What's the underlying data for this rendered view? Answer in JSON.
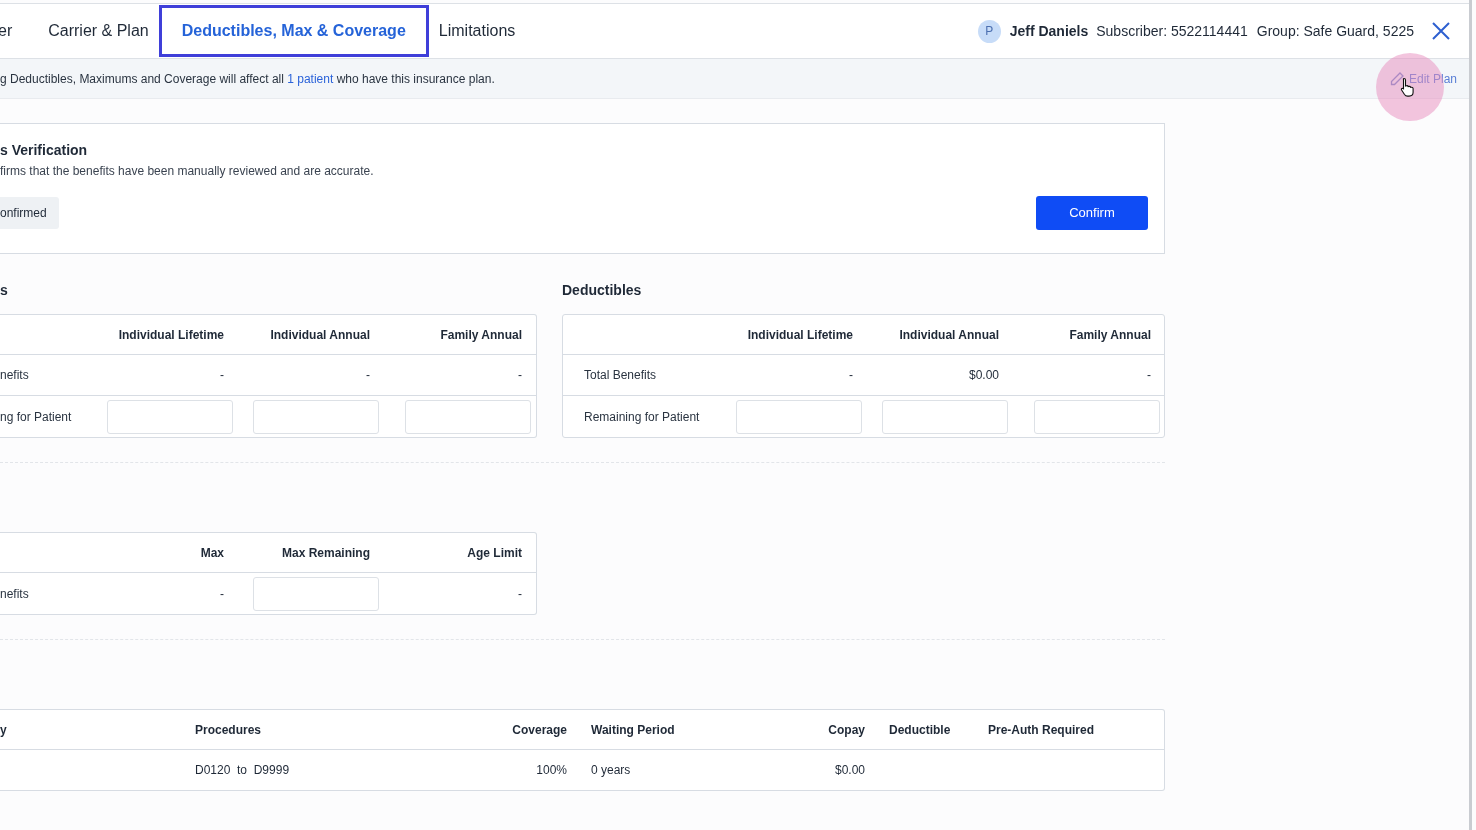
{
  "tabs": [
    {
      "label": "er",
      "selected": false
    },
    {
      "label": "Carrier & Plan",
      "selected": false
    },
    {
      "label": "Deductibles, Max & Coverage",
      "selected": true
    },
    {
      "label": "Limitations",
      "selected": false
    }
  ],
  "patient": {
    "avatar": "P",
    "name": "Jeff Daniels",
    "subscriber": "Subscriber: 5522114441",
    "group": "Group: Safe Guard, 5225"
  },
  "notice": {
    "before": "g Deductibles, Maximums and Coverage will affect all",
    "link": "1 patient",
    "after": "who have this insurance plan.",
    "edit_plan": "Edit Plan"
  },
  "verification": {
    "title": "s Verification",
    "description": "firms that the benefits have been manually reviewed and are accurate.",
    "status": "onfirmed",
    "confirm_button": "Confirm"
  },
  "maximums": {
    "heading": "s",
    "columns": [
      "",
      "Individual Lifetime",
      "Individual Annual",
      "Family Annual"
    ],
    "rows": [
      {
        "cells": [
          {
            "kind": "label",
            "value": "nefits"
          },
          {
            "kind": "text",
            "value": "-"
          },
          {
            "kind": "text",
            "value": "-"
          },
          {
            "kind": "text",
            "value": "-"
          }
        ]
      },
      {
        "cells": [
          {
            "kind": "label",
            "value": "ng for Patient"
          },
          {
            "kind": "input"
          },
          {
            "kind": "input"
          },
          {
            "kind": "input"
          }
        ]
      }
    ]
  },
  "deductibles": {
    "heading": "Deductibles",
    "columns": [
      "",
      "Individual Lifetime",
      "Individual Annual",
      "Family Annual"
    ],
    "rows": [
      {
        "cells": [
          {
            "kind": "label",
            "value": "Total Benefits"
          },
          {
            "kind": "text",
            "value": "-"
          },
          {
            "kind": "text",
            "value": "$0.00"
          },
          {
            "kind": "text",
            "value": "-"
          }
        ]
      },
      {
        "cells": [
          {
            "kind": "label",
            "value": "Remaining for Patient"
          },
          {
            "kind": "input"
          },
          {
            "kind": "input"
          },
          {
            "kind": "input"
          }
        ]
      }
    ]
  },
  "age_limits": {
    "columns": [
      "",
      "Max",
      "Max Remaining",
      "Age Limit"
    ],
    "rows": [
      {
        "cells": [
          {
            "kind": "label",
            "value": "nefits"
          },
          {
            "kind": "text",
            "value": "-"
          },
          {
            "kind": "input"
          },
          {
            "kind": "text",
            "value": "-"
          }
        ]
      }
    ]
  },
  "coverage": {
    "columns": [
      "y",
      "Procedures",
      "Coverage",
      "Waiting Period",
      "Copay",
      "Deductible",
      "Pre-Auth Required"
    ],
    "rows": [
      {
        "procedures": "D0120  to  D9999",
        "coverage": "100%",
        "waiting_period": "0 years",
        "copay": "$0.00"
      }
    ]
  }
}
